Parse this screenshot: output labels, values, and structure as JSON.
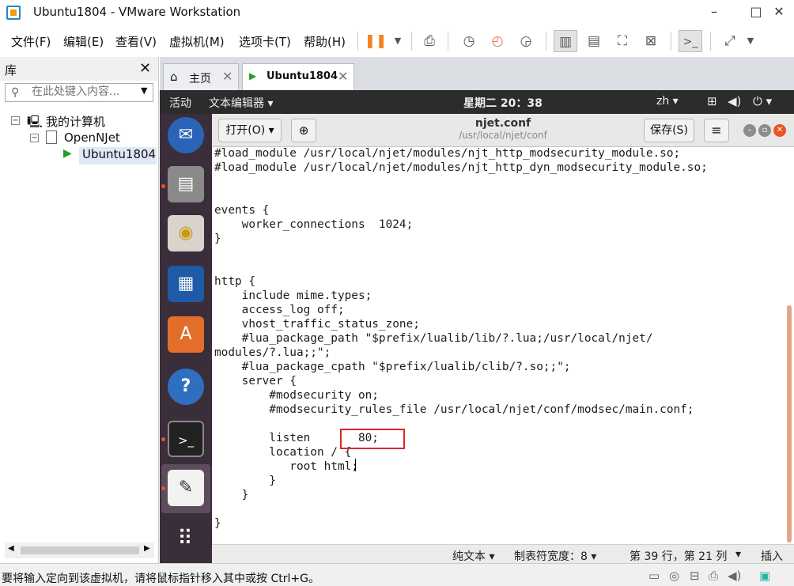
{
  "window": {
    "title": "Ubuntu1804 - VMware Workstation",
    "minimize": "–",
    "maximize": "□",
    "close": "✕"
  },
  "menu": {
    "file": "文件(F)",
    "edit": "编辑(E)",
    "view": "查看(V)",
    "vm": "虚拟机(M)",
    "tabs": "选项卡(T)",
    "help": "帮助(H)"
  },
  "library": {
    "title": "库",
    "close": "✕",
    "search_placeholder": "在此处键入内容...",
    "tree": {
      "my_computer": "我的计算机",
      "openNJet": "OpenNJet",
      "vm": "Ubuntu1804"
    }
  },
  "tabs": [
    {
      "label": "主页",
      "icon": "home-icon"
    },
    {
      "label": "Ubuntu1804",
      "icon": "vm-icon"
    }
  ],
  "ubuntu": {
    "activities": "活动",
    "app_menu": "文本编辑器 ▾",
    "clock": "星期二 20：38",
    "lang": "zh ▾",
    "power": "⏻ ▾"
  },
  "gedit": {
    "open": "打开(O) ▾",
    "doc_title": "njet.conf",
    "doc_path": "/usr/local/njet/conf",
    "save": "保存(S)",
    "menu": "≡",
    "code": "#load_module /usr/local/njet/modules/njt_http_modsecurity_module.so;\n#load_module /usr/local/njet/modules/njt_http_dyn_modsecurity_module.so;\n\n\nevents {\n    worker_connections  1024;\n}\n\n\nhttp {\n    include mime.types;\n    access_log off;\n    vhost_traffic_status_zone;\n    #lua_package_path \"$prefix/lualib/lib/?.lua;/usr/local/njet/\nmodules/?.lua;;\";\n    #lua_package_cpath \"$prefix/lualib/clib/?.so;;\";\n    server {\n        #modsecurity on;\n        #modsecurity_rules_file /usr/local/njet/conf/modsec/main.conf;\n\n        listen       80;\n        location / {\n           root html;\n        }\n    }\n\n}",
    "status": {
      "syntax": "纯文本 ▾",
      "tab_width": "制表符宽度：8 ▾",
      "position": "第 39 行，第 21 列",
      "position_dd": "▾",
      "mode": "插入"
    }
  },
  "vm_status": {
    "message": "要将输入定向到该虚拟机，请将鼠标指针移入其中或按 Ctrl+G。"
  },
  "colors": {
    "ubuntu_dark": "#2c2c2c",
    "dock": "#3a2e3a",
    "ubuntu_orange": "#e95420",
    "highlight_box": "#e0262a",
    "vmware_pause": "#f5821f"
  }
}
